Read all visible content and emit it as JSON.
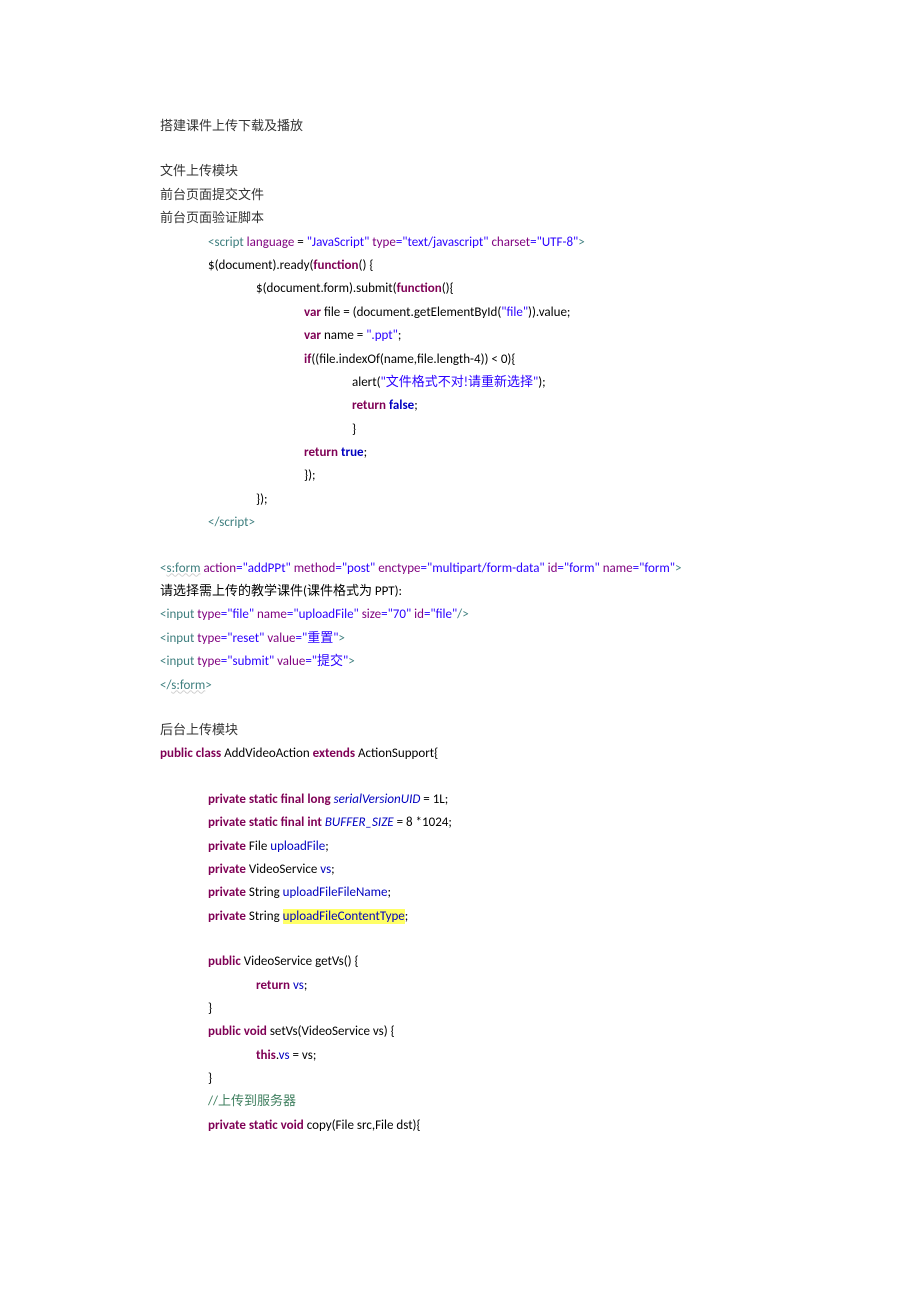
{
  "title": "搭建课件上传下载及播放",
  "headings": {
    "h1": "文件上传模块",
    "h2": "前台页面提交文件",
    "h3": "前台页面验证脚本",
    "h4": "后台上传模块"
  },
  "script": {
    "open_tag_lt": "<",
    "open_tag_name": "script",
    "attr_language_name": " language",
    "attr_language_eq": " = ",
    "attr_language_val": "\"JavaScript\"",
    "attr_type_name": " type",
    "attr_type_val": "=\"text/javascript\"",
    "attr_charset_name": " charset",
    "attr_charset_val": "=\"UTF-8\"",
    "open_tag_gt": ">",
    "l2_pre": "$(document).ready(",
    "l2_kw": "function",
    "l2_post": "() {",
    "l3_pre": "$(document.form).submit(",
    "l3_kw": "function",
    "l3_post": "(){",
    "l4_kw": "var",
    "l4_rest": " file = (document.getElementById(",
    "l4_str": "\"file\"",
    "l4_end": ")).value;",
    "l5_kw": "var",
    "l5_rest": " name = ",
    "l5_str": "\".ppt\"",
    "l5_end": ";",
    "l6_kw": "if",
    "l6_rest": "((file.indexOf(name,file.length-4)) < 0){",
    "l7_pre": "alert(",
    "l7_str": "\"文件格式不对!请重新选择\"",
    "l7_end": ");",
    "l8_kw": "return",
    "l8_val": " false",
    "l8_end": ";",
    "l9": "}",
    "l10_kw": "return",
    "l10_val": " true",
    "l10_end": ";",
    "l11": "});",
    "l12": "});",
    "close_lt": "</",
    "close_name": "script",
    "close_gt": ">"
  },
  "form": {
    "l1_lt": "<",
    "l1_name": "s:form",
    "l1_a1n": " action",
    "l1_a1v": "=\"addPPt\"",
    "l1_a2n": " method",
    "l1_a2v": "=\"post\"",
    "l1_a3n": " enctype",
    "l1_a3v": "=\"multipart/form-data\"",
    "l1_a4n": " id",
    "l1_a4v": "=\"form\"",
    "l1_a5n": " name",
    "l1_a5v": "=\"form\"",
    "l1_gt": ">",
    "l2": "请选择需上传的教学课件(课件格式为 PPT):",
    "l3_lt": "<",
    "l3_name": "input",
    "l3_a1n": " type",
    "l3_a1v": "=\"file\"",
    "l3_a2n": " name",
    "l3_a2v": "=\"uploadFile\"",
    "l3_a3n": " size",
    "l3_a3v": "=\"70\"",
    "l3_a4n": " id",
    "l3_a4v": "=\"file\"",
    "l3_gt": "/>",
    "l4_lt": "<",
    "l4_name": "input",
    "l4_a1n": " type",
    "l4_a1v": "=\"reset\"",
    "l4_a2n": " value",
    "l4_a2v": "=\"重置\"",
    "l4_gt": ">",
    "l5_lt": "<",
    "l5_name": "input",
    "l5_a1n": " type",
    "l5_a1v": "=\"submit\"",
    "l5_a2n": " value",
    "l5_a2v": "=\"提交\"",
    "l5_gt": ">",
    "l6_lt": "</",
    "l6_name": "s:form",
    "l6_gt": ">"
  },
  "java": {
    "l1_kw1": "public",
    "l1_kw2": " class",
    "l1_mid": " AddVideoAction ",
    "l1_kw3": "extends",
    "l1_end": " ActionSupport{",
    "f1_kw": "private static final long",
    "f1_name": " serialVersionUID",
    "f1_end": " = 1L;",
    "f2_kw": "private static final int",
    "f2_name": " BUFFER_SIZE",
    "f2_end": " = 8 *1024;",
    "f3_kw": "private",
    "f3_type": " File ",
    "f3_name": "uploadFile",
    "f3_end": ";",
    "f4_kw": "private",
    "f4_type": " VideoService ",
    "f4_name": "vs",
    "f4_end": ";",
    "f5_kw": "private",
    "f5_type": " String ",
    "f5_name": "uploadFileFileName",
    "f5_end": ";",
    "f6_kw": "private",
    "f6_type": " String ",
    "f6_name": "uploadFileContentType",
    "f6_end": ";",
    "m1_kw": "public",
    "m1_sig": " VideoService getVs() {",
    "m1_ret_kw": "return",
    "m1_ret_val": " vs",
    "m1_ret_end": ";",
    "m1_close": "}",
    "m2_kw": "public void",
    "m2_sig": " setVs(VideoService vs) {",
    "m2_this": "this",
    "m2_dot": ".",
    "m2_field": "vs",
    "m2_assign": " = vs;",
    "m2_close": "}",
    "comment": "//上传到服务器",
    "m3_kw": "private static void",
    "m3_sig": " copy(File src,File dst){"
  }
}
